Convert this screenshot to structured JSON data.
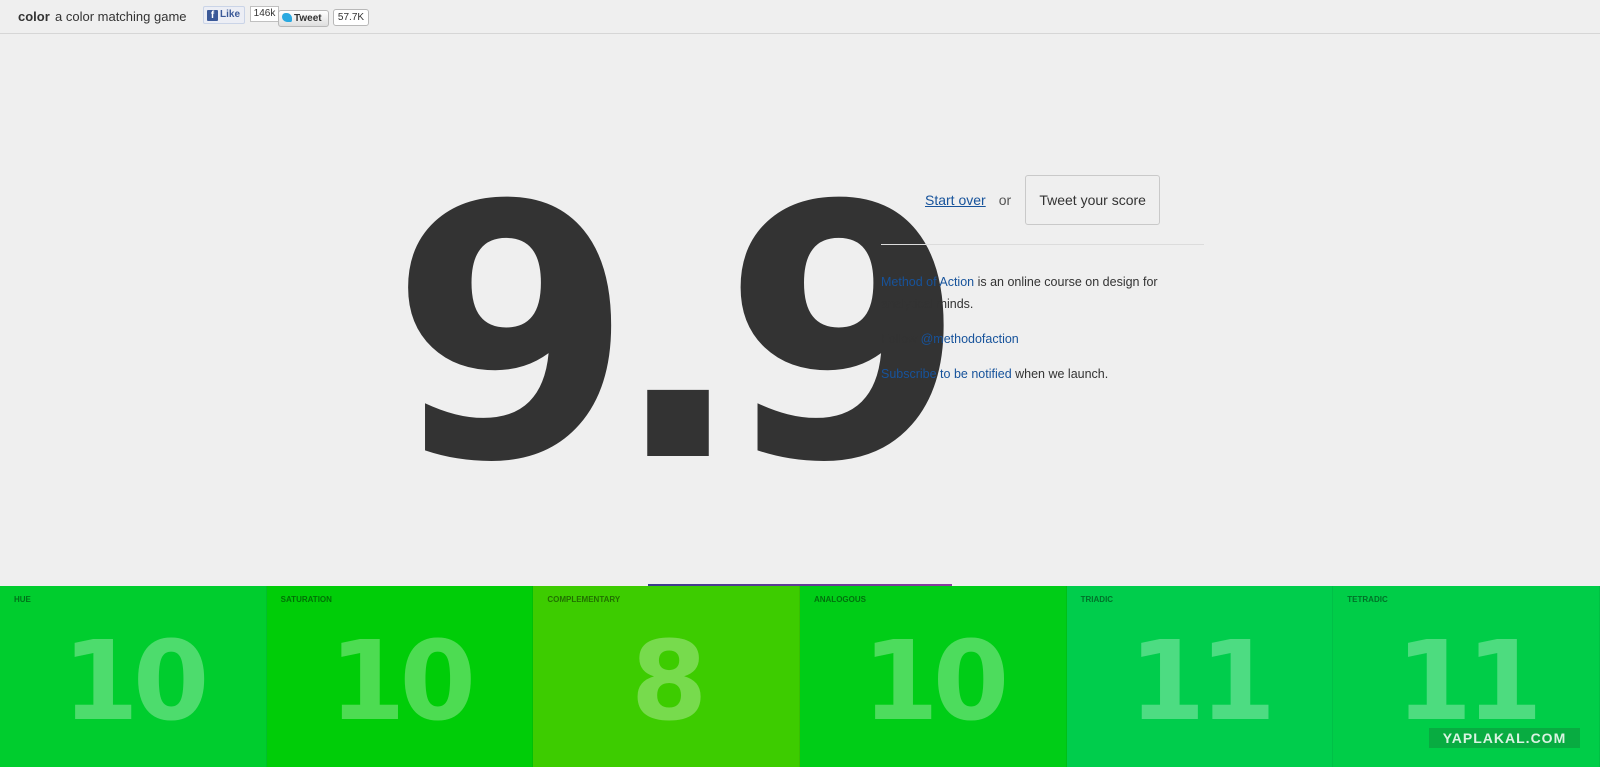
{
  "header": {
    "brand": "color",
    "tagline": "a color matching game",
    "fb_like_label": "Like",
    "fb_like_count": "146k",
    "tweet_label": "Tweet",
    "tweet_count": "57.7K"
  },
  "result": {
    "score": "9.9"
  },
  "actions": {
    "start_over": "Start over",
    "or": "or",
    "tweet_score": "Tweet your score"
  },
  "info": {
    "course_link": "Method of Action",
    "course_text": " is an online course on design for analytical minds.",
    "follow_text": "Follow ",
    "follow_link": "@methodofaction",
    "subscribe_link": "Subscribe to be notified",
    "subscribe_text": " when we launch."
  },
  "tiles": [
    {
      "label": "HUE",
      "score": "10",
      "color": "#00cd2e"
    },
    {
      "label": "SATURATION",
      "score": "10",
      "color": "#00cd08"
    },
    {
      "label": "COMPLEMENTARY",
      "score": "8",
      "color": "#3dcc00"
    },
    {
      "label": "ANALOGOUS",
      "score": "10",
      "color": "#00cd17"
    },
    {
      "label": "TRIADIC",
      "score": "11",
      "color": "#00cd4c"
    },
    {
      "label": "TETRADIC",
      "score": "11",
      "color": "#00cd48"
    }
  ],
  "watermark": "YAPLAKAL.COM"
}
